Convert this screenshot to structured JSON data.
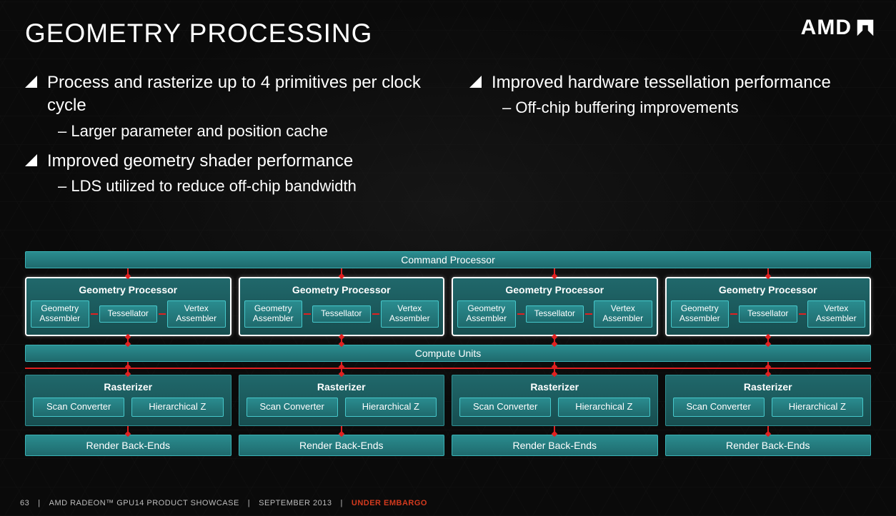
{
  "header": {
    "title": "GEOMETRY PROCESSING",
    "logo_text": "AMD"
  },
  "bullets": {
    "left": [
      {
        "text": "Process and rasterize up to 4 primitives per clock cycle",
        "subs": [
          "Larger parameter and position cache"
        ]
      },
      {
        "text": "Improved geometry shader performance",
        "subs": [
          "LDS utilized to reduce off-chip bandwidth"
        ]
      }
    ],
    "right": [
      {
        "text": "Improved hardware tessellation performance",
        "subs": [
          "Off-chip buffering improvements"
        ]
      }
    ]
  },
  "diagram": {
    "command_processor": "Command Processor",
    "geometry_processor": {
      "title": "Geometry Processor",
      "count": 4,
      "units": [
        "Geometry Assembler",
        "Tessellator",
        "Vertex Assembler"
      ]
    },
    "compute_units": "Compute Units",
    "rasterizer": {
      "title": "Rasterizer",
      "count": 4,
      "units": [
        "Scan Converter",
        "Hierarchical Z"
      ]
    },
    "render_backends": {
      "label": "Render Back-Ends",
      "count": 4
    }
  },
  "footer": {
    "page": "63",
    "product": "AMD RADEON™ GPU14 PRODUCT SHOWCASE",
    "date": "SEPTEMBER 2013",
    "status": "UNDER EMBARGO"
  }
}
